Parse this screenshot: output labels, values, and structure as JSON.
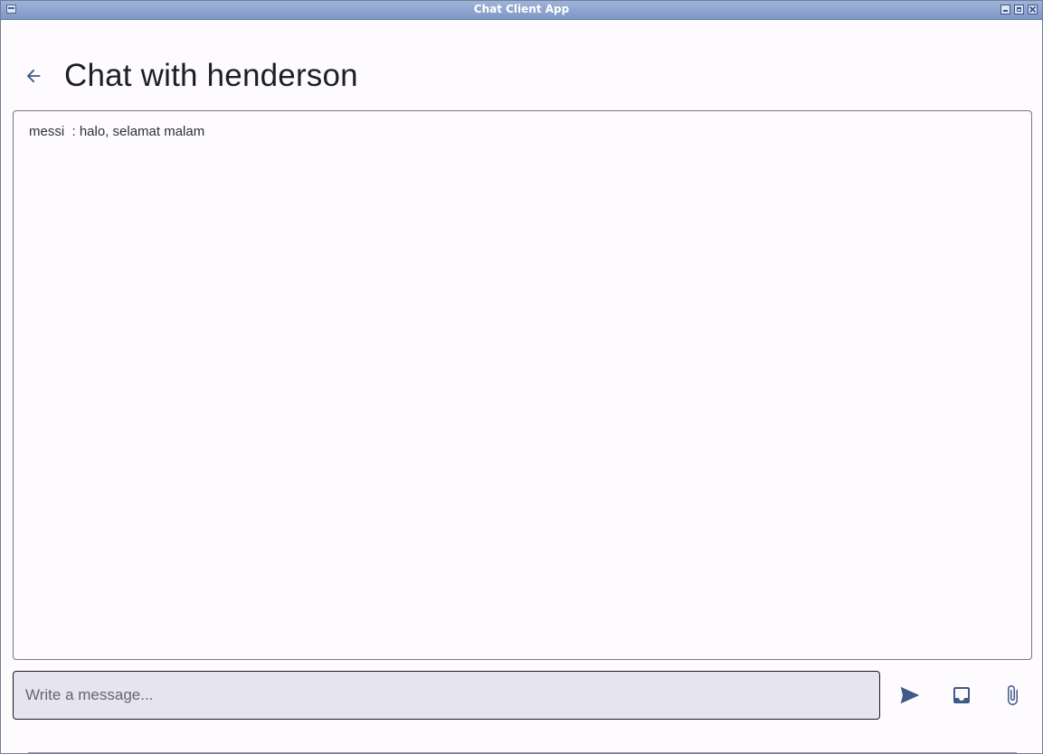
{
  "window": {
    "title": "Chat Client App"
  },
  "header": {
    "title": "Chat with henderson"
  },
  "messages": [
    {
      "sender": "messi",
      "separator": " : ",
      "text": "halo, selamat malam",
      "line": "messi  : halo, selamat malam"
    }
  ],
  "composer": {
    "placeholder": "Write a message...",
    "value": ""
  },
  "icons": {
    "back": "arrow-left-icon",
    "send": "send-icon",
    "inbox": "inbox-icon",
    "attach": "paperclip-icon"
  },
  "colors": {
    "accent": "#405a86",
    "title_text": "#1f1f23",
    "background": "#fdfbfe",
    "input_background": "#e6e4ee",
    "titlebar": "#8ba2cf"
  }
}
